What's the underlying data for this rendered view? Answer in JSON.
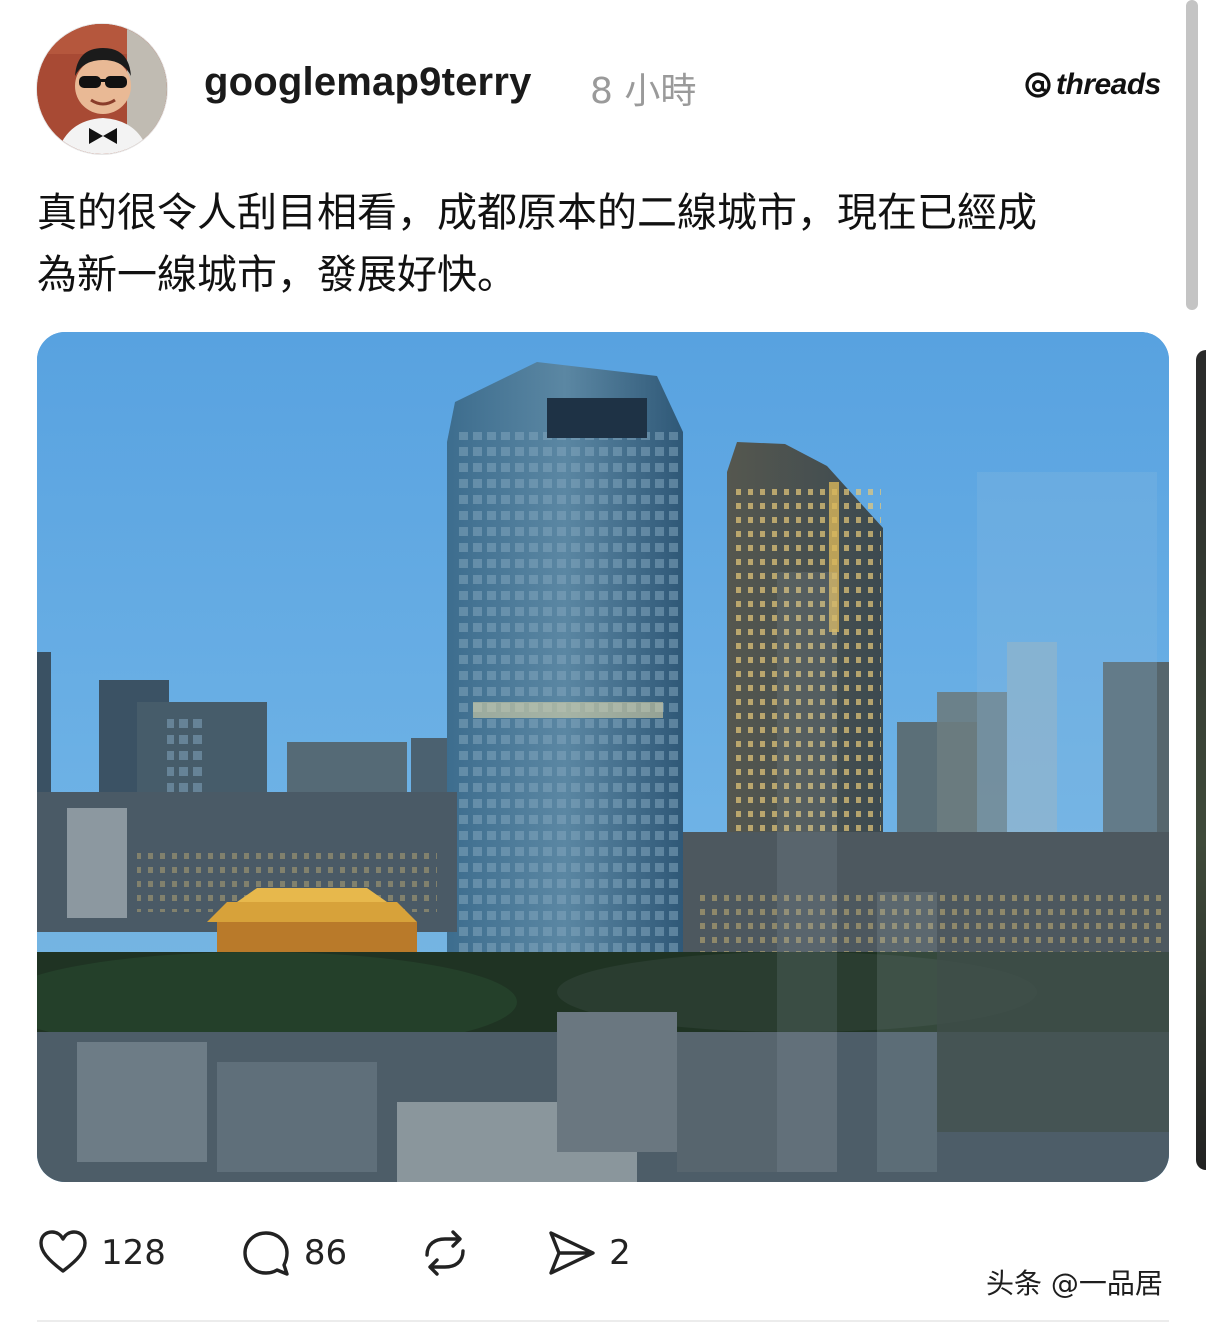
{
  "post": {
    "author": {
      "username": "googlemap9terry",
      "avatar_icon": "profile-photo-man-sunglasses-bowtie"
    },
    "timestamp": "8 小時",
    "brand": {
      "name": "threads",
      "icon": "threads-at-icon"
    },
    "text": {
      "line1": "真的很令人刮目相看，成都原本的二線城市，現在已經成",
      "line2": "為新一線城市，發展好快。"
    },
    "image": {
      "icon": "city-skyline-photo"
    },
    "actions": {
      "like": {
        "icon": "heart-icon",
        "count": "128"
      },
      "reply": {
        "icon": "comment-bubble-icon",
        "count": "86"
      },
      "repost": {
        "icon": "repost-arrows-icon"
      },
      "share": {
        "icon": "send-icon",
        "count": "2"
      }
    }
  },
  "watermark": "头条 @一品居",
  "colors": {
    "sky": "#5fa3de",
    "text": "#111111",
    "muted": "#9a9a9a"
  }
}
